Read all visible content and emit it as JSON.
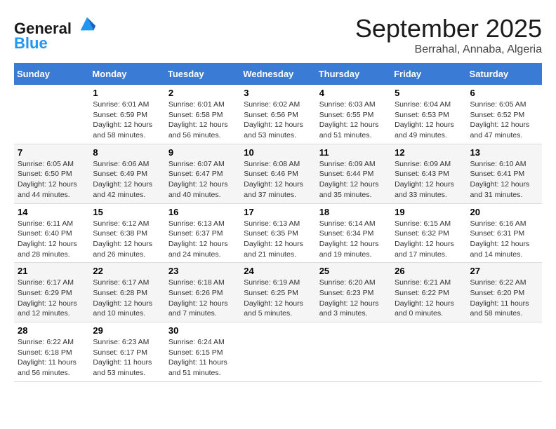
{
  "header": {
    "logo_line1": "General",
    "logo_line2": "Blue",
    "month": "September 2025",
    "location": "Berrahal, Annaba, Algeria"
  },
  "weekdays": [
    "Sunday",
    "Monday",
    "Tuesday",
    "Wednesday",
    "Thursday",
    "Friday",
    "Saturday"
  ],
  "weeks": [
    [
      {
        "day": "",
        "info": ""
      },
      {
        "day": "1",
        "info": "Sunrise: 6:01 AM\nSunset: 6:59 PM\nDaylight: 12 hours\nand 58 minutes."
      },
      {
        "day": "2",
        "info": "Sunrise: 6:01 AM\nSunset: 6:58 PM\nDaylight: 12 hours\nand 56 minutes."
      },
      {
        "day": "3",
        "info": "Sunrise: 6:02 AM\nSunset: 6:56 PM\nDaylight: 12 hours\nand 53 minutes."
      },
      {
        "day": "4",
        "info": "Sunrise: 6:03 AM\nSunset: 6:55 PM\nDaylight: 12 hours\nand 51 minutes."
      },
      {
        "day": "5",
        "info": "Sunrise: 6:04 AM\nSunset: 6:53 PM\nDaylight: 12 hours\nand 49 minutes."
      },
      {
        "day": "6",
        "info": "Sunrise: 6:05 AM\nSunset: 6:52 PM\nDaylight: 12 hours\nand 47 minutes."
      }
    ],
    [
      {
        "day": "7",
        "info": "Sunrise: 6:05 AM\nSunset: 6:50 PM\nDaylight: 12 hours\nand 44 minutes."
      },
      {
        "day": "8",
        "info": "Sunrise: 6:06 AM\nSunset: 6:49 PM\nDaylight: 12 hours\nand 42 minutes."
      },
      {
        "day": "9",
        "info": "Sunrise: 6:07 AM\nSunset: 6:47 PM\nDaylight: 12 hours\nand 40 minutes."
      },
      {
        "day": "10",
        "info": "Sunrise: 6:08 AM\nSunset: 6:46 PM\nDaylight: 12 hours\nand 37 minutes."
      },
      {
        "day": "11",
        "info": "Sunrise: 6:09 AM\nSunset: 6:44 PM\nDaylight: 12 hours\nand 35 minutes."
      },
      {
        "day": "12",
        "info": "Sunrise: 6:09 AM\nSunset: 6:43 PM\nDaylight: 12 hours\nand 33 minutes."
      },
      {
        "day": "13",
        "info": "Sunrise: 6:10 AM\nSunset: 6:41 PM\nDaylight: 12 hours\nand 31 minutes."
      }
    ],
    [
      {
        "day": "14",
        "info": "Sunrise: 6:11 AM\nSunset: 6:40 PM\nDaylight: 12 hours\nand 28 minutes."
      },
      {
        "day": "15",
        "info": "Sunrise: 6:12 AM\nSunset: 6:38 PM\nDaylight: 12 hours\nand 26 minutes."
      },
      {
        "day": "16",
        "info": "Sunrise: 6:13 AM\nSunset: 6:37 PM\nDaylight: 12 hours\nand 24 minutes."
      },
      {
        "day": "17",
        "info": "Sunrise: 6:13 AM\nSunset: 6:35 PM\nDaylight: 12 hours\nand 21 minutes."
      },
      {
        "day": "18",
        "info": "Sunrise: 6:14 AM\nSunset: 6:34 PM\nDaylight: 12 hours\nand 19 minutes."
      },
      {
        "day": "19",
        "info": "Sunrise: 6:15 AM\nSunset: 6:32 PM\nDaylight: 12 hours\nand 17 minutes."
      },
      {
        "day": "20",
        "info": "Sunrise: 6:16 AM\nSunset: 6:31 PM\nDaylight: 12 hours\nand 14 minutes."
      }
    ],
    [
      {
        "day": "21",
        "info": "Sunrise: 6:17 AM\nSunset: 6:29 PM\nDaylight: 12 hours\nand 12 minutes."
      },
      {
        "day": "22",
        "info": "Sunrise: 6:17 AM\nSunset: 6:28 PM\nDaylight: 12 hours\nand 10 minutes."
      },
      {
        "day": "23",
        "info": "Sunrise: 6:18 AM\nSunset: 6:26 PM\nDaylight: 12 hours\nand 7 minutes."
      },
      {
        "day": "24",
        "info": "Sunrise: 6:19 AM\nSunset: 6:25 PM\nDaylight: 12 hours\nand 5 minutes."
      },
      {
        "day": "25",
        "info": "Sunrise: 6:20 AM\nSunset: 6:23 PM\nDaylight: 12 hours\nand 3 minutes."
      },
      {
        "day": "26",
        "info": "Sunrise: 6:21 AM\nSunset: 6:22 PM\nDaylight: 12 hours\nand 0 minutes."
      },
      {
        "day": "27",
        "info": "Sunrise: 6:22 AM\nSunset: 6:20 PM\nDaylight: 11 hours\nand 58 minutes."
      }
    ],
    [
      {
        "day": "28",
        "info": "Sunrise: 6:22 AM\nSunset: 6:18 PM\nDaylight: 11 hours\nand 56 minutes."
      },
      {
        "day": "29",
        "info": "Sunrise: 6:23 AM\nSunset: 6:17 PM\nDaylight: 11 hours\nand 53 minutes."
      },
      {
        "day": "30",
        "info": "Sunrise: 6:24 AM\nSunset: 6:15 PM\nDaylight: 11 hours\nand 51 minutes."
      },
      {
        "day": "",
        "info": ""
      },
      {
        "day": "",
        "info": ""
      },
      {
        "day": "",
        "info": ""
      },
      {
        "day": "",
        "info": ""
      }
    ]
  ]
}
